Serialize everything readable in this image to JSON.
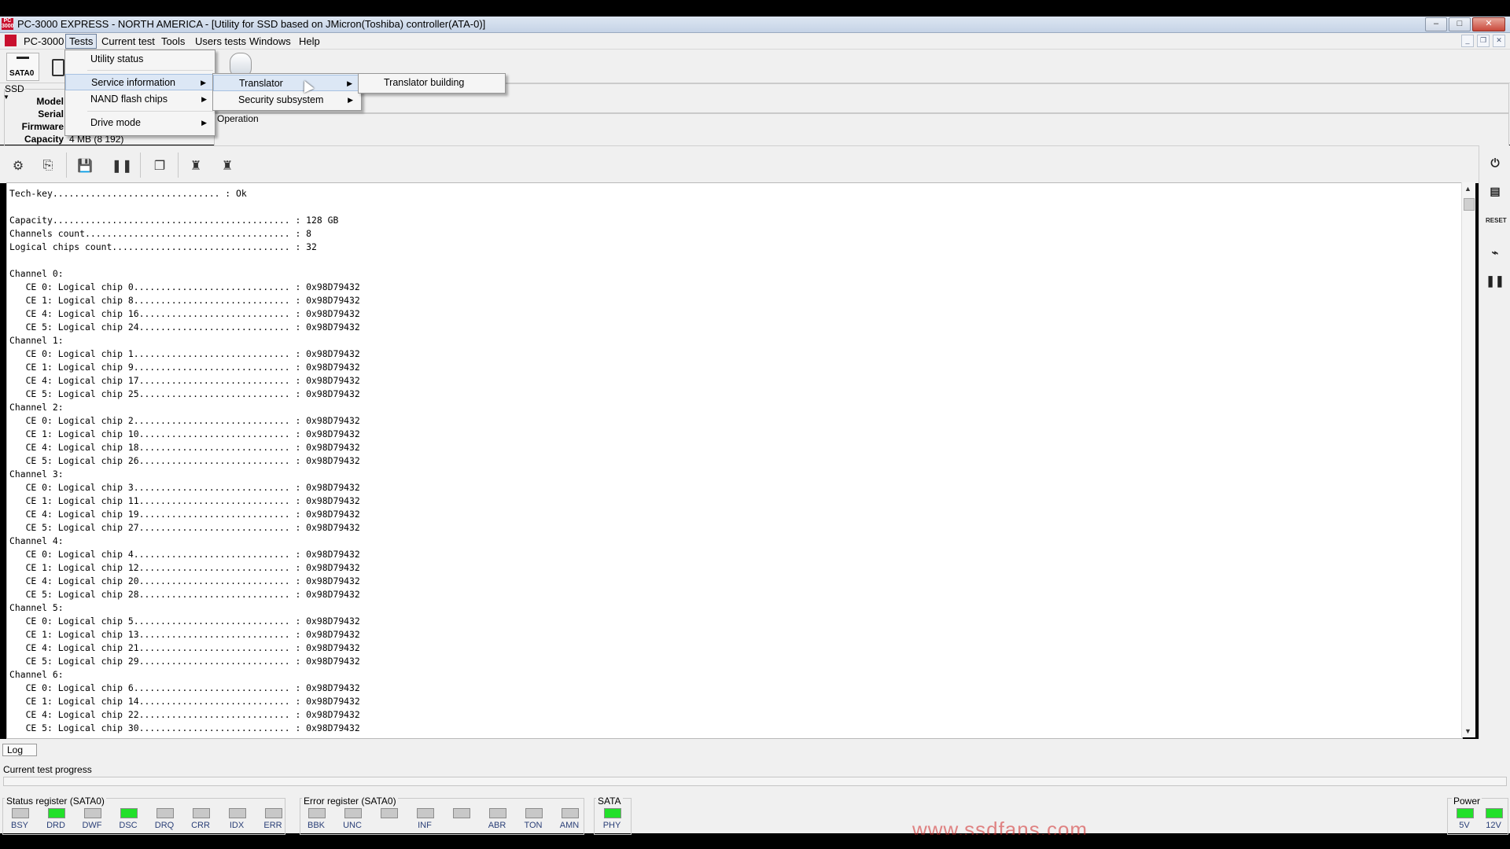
{
  "window": {
    "title": "PC-3000 EXPRESS - NORTH AMERICA - [Utility for SSD based on JMicron(Toshiba) controller(ATA-0)]",
    "icon_text": "PC 3000"
  },
  "menubar": {
    "items": [
      "PC-3000",
      "Tests",
      "Current test",
      "Tools",
      "Users tests",
      "Windows",
      "Help"
    ]
  },
  "toolbar": {
    "sata_label": "SATA0"
  },
  "ssd_panel": {
    "title": "SSD",
    "fields": [
      {
        "label": "Model",
        "value": ""
      },
      {
        "label": "Serial",
        "value": ""
      },
      {
        "label": "Firmware",
        "value": ""
      },
      {
        "label": "Capacity",
        "value": "4 MB (8 192)"
      }
    ],
    "operation_label": "Operation"
  },
  "menus": {
    "tests": [
      "Utility status",
      "Service information",
      "NAND flash chips",
      "Drive mode"
    ],
    "service_information": [
      "Translator",
      "Security subsystem"
    ],
    "translator": [
      "Translator building"
    ]
  },
  "log": {
    "tab_label": "Log",
    "lines": [
      "Tech-key............................... : Ok",
      "",
      "Capacity............................................ : 128 GB",
      "Channels count...................................... : 8",
      "Logical chips count................................. : 32",
      "",
      "Channel 0:",
      "   CE 0: Logical chip 0............................. : 0x98D79432",
      "   CE 1: Logical chip 8............................. : 0x98D79432",
      "   CE 4: Logical chip 16............................ : 0x98D79432",
      "   CE 5: Logical chip 24............................ : 0x98D79432",
      "Channel 1:",
      "   CE 0: Logical chip 1............................. : 0x98D79432",
      "   CE 1: Logical chip 9............................. : 0x98D79432",
      "   CE 4: Logical chip 17............................ : 0x98D79432",
      "   CE 5: Logical chip 25............................ : 0x98D79432",
      "Channel 2:",
      "   CE 0: Logical chip 2............................. : 0x98D79432",
      "   CE 1: Logical chip 10............................ : 0x98D79432",
      "   CE 4: Logical chip 18............................ : 0x98D79432",
      "   CE 5: Logical chip 26............................ : 0x98D79432",
      "Channel 3:",
      "   CE 0: Logical chip 3............................. : 0x98D79432",
      "   CE 1: Logical chip 11............................ : 0x98D79432",
      "   CE 4: Logical chip 19............................ : 0x98D79432",
      "   CE 5: Logical chip 27............................ : 0x98D79432",
      "Channel 4:",
      "   CE 0: Logical chip 4............................. : 0x98D79432",
      "   CE 1: Logical chip 12............................ : 0x98D79432",
      "   CE 4: Logical chip 20............................ : 0x98D79432",
      "   CE 5: Logical chip 28............................ : 0x98D79432",
      "Channel 5:",
      "   CE 0: Logical chip 5............................. : 0x98D79432",
      "   CE 1: Logical chip 13............................ : 0x98D79432",
      "   CE 4: Logical chip 21............................ : 0x98D79432",
      "   CE 5: Logical chip 29............................ : 0x98D79432",
      "Channel 6:",
      "   CE 0: Logical chip 6............................. : 0x98D79432",
      "   CE 1: Logical chip 14............................ : 0x98D79432",
      "   CE 4: Logical chip 22............................ : 0x98D79432",
      "   CE 5: Logical chip 30............................ : 0x98D79432"
    ]
  },
  "progress": {
    "label": "Current test progress",
    "value": 0
  },
  "status_register": {
    "title": "Status register (SATA0)",
    "leds": [
      {
        "name": "BSY",
        "on": false
      },
      {
        "name": "DRD",
        "on": true
      },
      {
        "name": "DWF",
        "on": false
      },
      {
        "name": "DSC",
        "on": true
      },
      {
        "name": "DRQ",
        "on": false
      },
      {
        "name": "CRR",
        "on": false
      },
      {
        "name": "IDX",
        "on": false
      },
      {
        "name": "ERR",
        "on": false
      }
    ]
  },
  "error_register": {
    "title": "Error register (SATA0)",
    "leds": [
      {
        "name": "BBK",
        "on": false
      },
      {
        "name": "UNC",
        "on": false
      },
      {
        "name": "",
        "on": false
      },
      {
        "name": "INF",
        "on": false
      },
      {
        "name": "",
        "on": false
      },
      {
        "name": "ABR",
        "on": false
      },
      {
        "name": "TON",
        "on": false
      },
      {
        "name": "AMN",
        "on": false
      }
    ]
  },
  "sata": {
    "title": "SATA",
    "leds": [
      {
        "name": "PHY",
        "on": true
      }
    ]
  },
  "power": {
    "title": "Power",
    "leds": [
      {
        "name": "5V",
        "on": true
      },
      {
        "name": "12V",
        "on": true
      }
    ]
  },
  "watermark": "www.ssdfans.com",
  "colors": {
    "led_on": "#22e02a",
    "led_off": "#c8c8c8",
    "menu_highlight": "#dce7f5"
  }
}
